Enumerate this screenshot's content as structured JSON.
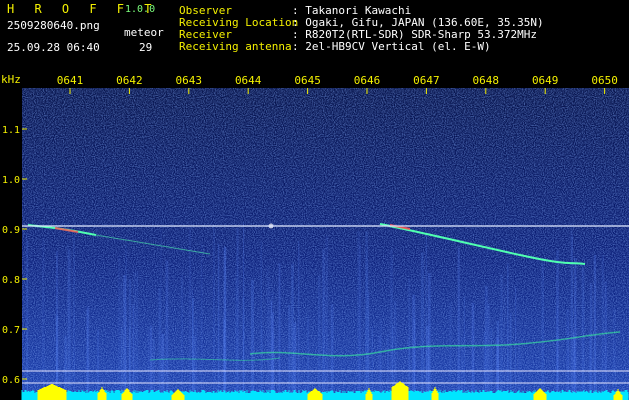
{
  "header": {
    "logo": "H R O F F T",
    "version": "1.0.0",
    "filename": "2509280640.png",
    "timestamp": "25.09.28 06:40",
    "meteor_label": "meteor",
    "meteor_count": "29",
    "info": [
      {
        "label": "Observer",
        "value": ": Takanori Kawachi"
      },
      {
        "label": "Receiving Location",
        "value": ": Ogaki, Gifu, JAPAN (136.60E, 35.35N)"
      },
      {
        "label": "Receiver",
        "value": ": R820T2(RTL-SDR) SDR-Sharp 53.372MHz"
      },
      {
        "label": "Receiving antenna",
        "value": ": 2el-HB9CV Vertical (el. E-W)"
      }
    ]
  },
  "spectrogram": {
    "y_unit": "kHz",
    "x_ticks": [
      "0641",
      "0642",
      "0643",
      "0644",
      "0645",
      "0646",
      "0647",
      "0648",
      "0649",
      "0650"
    ],
    "y_ticks": [
      "1.1",
      "1.0",
      "0.9",
      "0.8",
      "0.7",
      "0.6"
    ],
    "colors": {
      "background": "#0a1a6e",
      "text": "#f4f100",
      "grid": "#e6e6ff",
      "signal": "#ffffff",
      "trail": "#50ffb0",
      "level": "#00e5ff",
      "peak": "#ffff00"
    }
  }
}
